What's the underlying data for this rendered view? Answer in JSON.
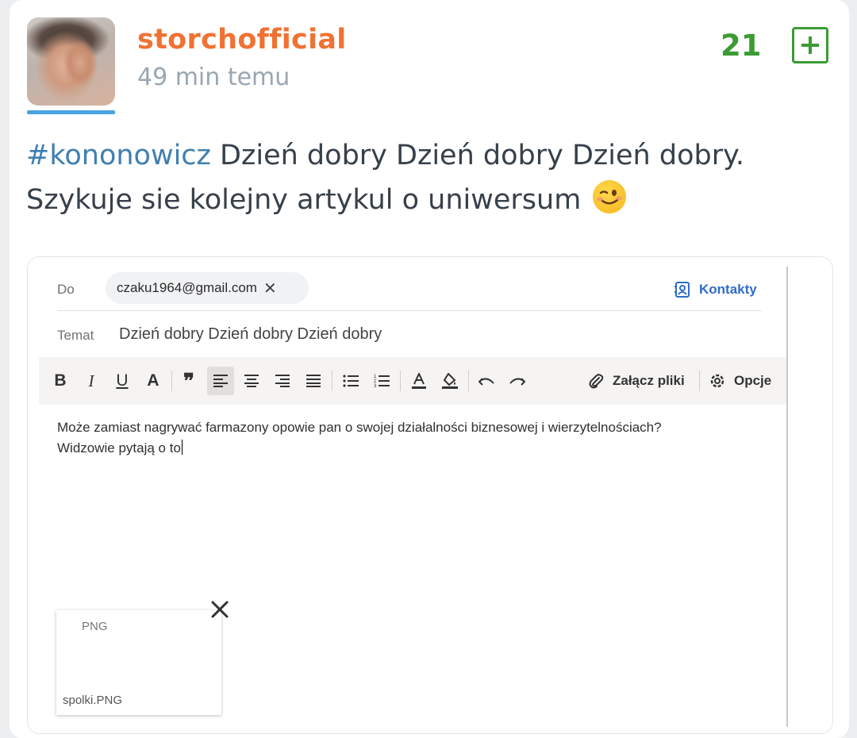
{
  "post": {
    "username": "storchofficial",
    "time_ago": "49 min temu",
    "votes": "21",
    "tag": "#kononowicz",
    "text_line1": " Dzień dobry Dzień dobry Dzień dobry.",
    "text_line2": "Szykuje sie kolejny artykul o uniwersum",
    "emoji": "wink-emoji",
    "colors": {
      "username": "#f07233",
      "votes": "#3c9b34",
      "tag": "#3f7fb0"
    }
  },
  "email": {
    "to_label": "Do",
    "recipient": "czaku1964@gmail.com",
    "contacts_label": "Kontakty",
    "subject_label": "Temat",
    "subject": "Dzień dobry Dzień dobry Dzień dobry",
    "toolbar": {
      "bold": "B",
      "italic": "I",
      "underline": "U",
      "font": "A",
      "quote": "❞",
      "attach_label": "Załącz pliki",
      "options_label": "Opcje"
    },
    "body_line1": "Może zamiast nagrywać farmazony opowie pan o swojej działalności biznesowej i wierzytelnościach?",
    "body_line2": "Widzowie pytają o to",
    "attachment": {
      "type": "PNG",
      "filename": "spolki.PNG"
    }
  }
}
